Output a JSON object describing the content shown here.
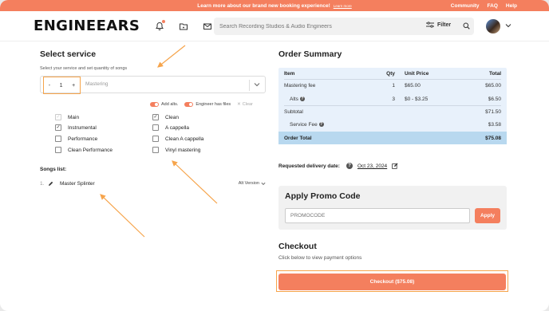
{
  "banner": {
    "text": "Learn more about our brand new booking experience!",
    "link": "Learn more",
    "links": [
      "Community",
      "FAQ",
      "Help"
    ]
  },
  "nav": {
    "logo": "ENGINEEARS",
    "search_placeholder": "Search Recording Studios & Audio Engineers",
    "filter_label": "Filter"
  },
  "service": {
    "title": "Select service",
    "subtitle": "Select your service and set quantity of songs",
    "quantity": "1",
    "minus": "-",
    "plus": "+",
    "selected": "Mastering",
    "toggle_alts": "Add alts.",
    "toggle_files": "Engineer has files",
    "clear": "Clear",
    "options": [
      {
        "label": "Main",
        "checked": true,
        "disabled": true
      },
      {
        "label": "Clean",
        "checked": true,
        "disabled": false
      },
      {
        "label": "Instrumental",
        "checked": true,
        "disabled": false
      },
      {
        "label": "A cappella",
        "checked": false,
        "disabled": false
      },
      {
        "label": "Performance",
        "checked": false,
        "disabled": false
      },
      {
        "label": "Clean A cappella",
        "checked": false,
        "disabled": false
      },
      {
        "label": "Clean Performance",
        "checked": false,
        "disabled": false
      },
      {
        "label": "Vinyl mastering",
        "checked": false,
        "disabled": false
      }
    ],
    "songs_title": "Songs list:",
    "songs": [
      {
        "index": "1.",
        "name": "Master Splinter",
        "alt": "Alt Version"
      }
    ]
  },
  "order": {
    "title": "Order Summary",
    "headers": [
      "Item",
      "Qty",
      "Unit Price",
      "Total"
    ],
    "rows": [
      {
        "item": "Mastering fee",
        "qty": "1",
        "unit": "$65.00",
        "total": "$65.00"
      },
      {
        "item": "Alts",
        "qty": "3",
        "unit": "$0 - $3.25",
        "total": "$6.50"
      }
    ],
    "subtotal_label": "Subtotal",
    "subtotal": "$71.50",
    "fee_label": "Service Fee",
    "fee": "$3.58",
    "total_label": "Order Total",
    "total": "$75.08"
  },
  "delivery": {
    "label": "Requested delivery date:",
    "date": "Oct 23, 2024"
  },
  "promo": {
    "title": "Apply Promo Code",
    "placeholder": "PROMOCODE",
    "apply": "Apply"
  },
  "checkout": {
    "title": "Checkout",
    "subtitle": "Click below to view payment options",
    "button": "Checkout ($75.08)"
  },
  "colors": {
    "accent": "#f47f5e",
    "highlight": "#f6a44b",
    "summary_bg": "#e8f1fb",
    "total_bg": "#b8d8ef"
  }
}
